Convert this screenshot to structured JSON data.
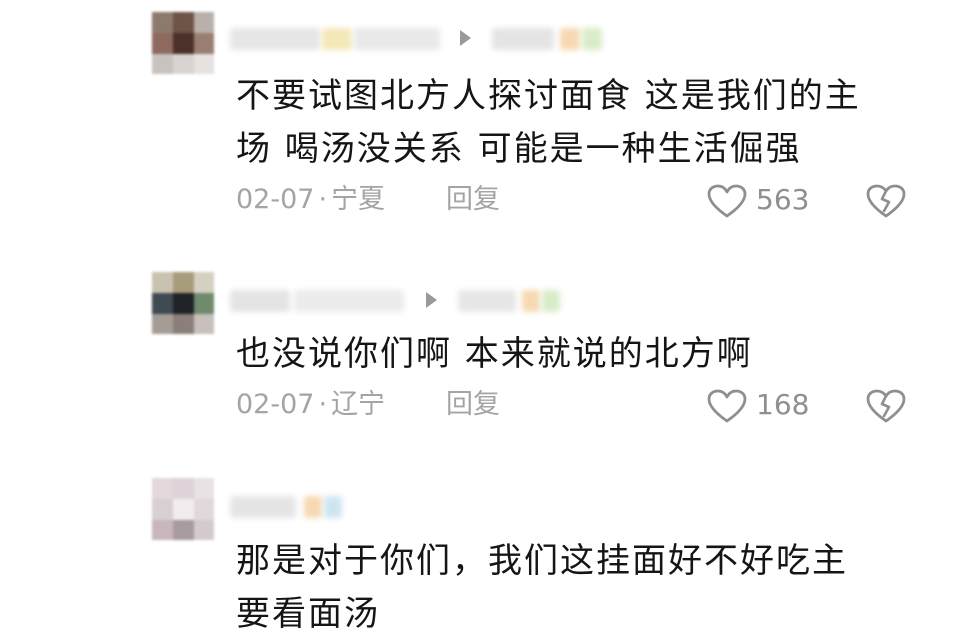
{
  "comments": [
    {
      "username": "",
      "text_lines": [
        "不要试图北方人探讨面食 这是我们的主",
        "场 喝汤没关系 可能是一种生活倔强"
      ],
      "date": "02-07",
      "location": "宁夏",
      "reply_label": "回复",
      "likes": "563"
    },
    {
      "username": "",
      "text_lines": [
        "也没说你们啊 本来就说的北方啊"
      ],
      "date": "02-07",
      "location": "辽宁",
      "reply_label": "回复",
      "likes": "168"
    },
    {
      "username": "",
      "text_lines": [
        "那是对于你们，我们这挂面好不好吃主",
        "要看面汤"
      ]
    }
  ],
  "colors": {
    "text": "#151515",
    "meta": "#a4a4a4",
    "icon": "#8f8f8f"
  },
  "icons": {
    "like": "heart-outline-icon",
    "dislike": "broken-heart-icon",
    "reply_to": "play-triangle-icon"
  }
}
